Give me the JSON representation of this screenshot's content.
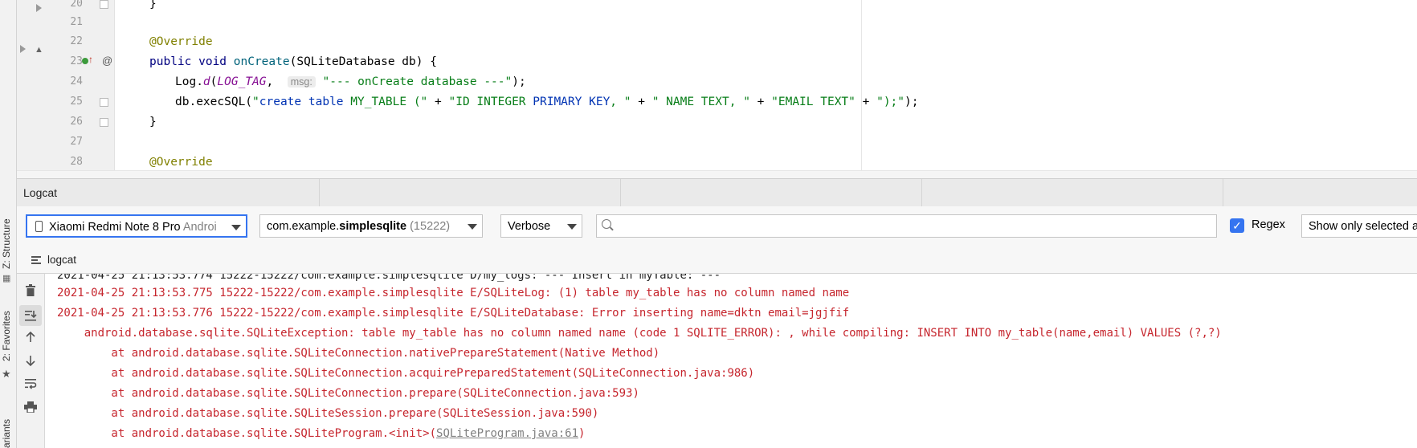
{
  "side_panels": {
    "structure": "Z: Structure",
    "favorites": "2: Favorites",
    "variants": "ariants"
  },
  "editor": {
    "lines": [
      {
        "num": "20",
        "text": "}"
      },
      {
        "num": "21",
        "text": ""
      },
      {
        "num": "22",
        "annotation": "@Override"
      },
      {
        "num": "23",
        "kw": "public void ",
        "fn": "onCreate",
        "rest": "(SQLiteDatabase db) {"
      },
      {
        "num": "24",
        "prefix": "Log.",
        "method": "d",
        "arg": "LOG_TAG",
        "hint": "msg:",
        "str": "\"--- onCreate database ---\"",
        "end": ");"
      },
      {
        "num": "25",
        "prefix": "db.execSQL(",
        "s1": "\"",
        "s1b": "create table",
        "s1c": " MY_TABLE (\"",
        "p1": " + ",
        "s2a": "\"ID INTEGER ",
        "s2b": "PRIMARY KEY",
        "s2c": ", \"",
        "p2": " + ",
        "s3": "\" NAME TEXT, \"",
        "p3": " + ",
        "s4": "\"EMAIL TEXT\"",
        "p4": " + ",
        "s5": "\");\"",
        "end": ");"
      },
      {
        "num": "26",
        "text": "}"
      },
      {
        "num": "27",
        "text": ""
      },
      {
        "num": "28",
        "annotation": "@Override"
      }
    ]
  },
  "logcat": {
    "title": "Logcat",
    "device": {
      "name": "Xiaomi Redmi Note 8 Pro",
      "suffix": " Androi"
    },
    "process": {
      "name_prefix": "com.example.",
      "name_bold": "simplesqlite",
      "pid": " (15222)"
    },
    "level": "Verbose",
    "search": {
      "value": "",
      "placeholder": ""
    },
    "regex": {
      "label": "Regex",
      "checked": true
    },
    "filter": "Show only selected app",
    "tab": "logcat",
    "lines": [
      {
        "level": "d",
        "text": "2021-04-25 21:13:53.774 15222-15222/com.example.simplesqlite D/my_logs: --- Insert in myTable: ---"
      },
      {
        "level": "e",
        "text": "2021-04-25 21:13:53.775 15222-15222/com.example.simplesqlite E/SQLiteLog: (1) table my_table has no column named name"
      },
      {
        "level": "e",
        "text": "2021-04-25 21:13:53.776 15222-15222/com.example.simplesqlite E/SQLiteDatabase: Error inserting name=dktn email=jgjfif"
      },
      {
        "level": "e",
        "text": "    android.database.sqlite.SQLiteException: table my_table has no column named name (code 1 SQLITE_ERROR): , while compiling: INSERT INTO my_table(name,email) VALUES (?,?)"
      },
      {
        "level": "e",
        "text": "        at android.database.sqlite.SQLiteConnection.nativePrepareStatement(Native Method)"
      },
      {
        "level": "e",
        "text": "        at android.database.sqlite.SQLiteConnection.acquirePreparedStatement(SQLiteConnection.java:986)"
      },
      {
        "level": "e",
        "text": "        at android.database.sqlite.SQLiteConnection.prepare(SQLiteConnection.java:593)"
      },
      {
        "level": "e",
        "text": "        at android.database.sqlite.SQLiteSession.prepare(SQLiteSession.java:590)"
      },
      {
        "level": "e",
        "text": "        at android.database.sqlite.SQLiteProgram.<init>(",
        "link": "SQLiteProgram.java:61",
        "tail": ")"
      }
    ]
  },
  "colors": {
    "error": "#c6262e",
    "accent": "#3574f0",
    "annotation": "#808000",
    "string": "#067d17"
  }
}
